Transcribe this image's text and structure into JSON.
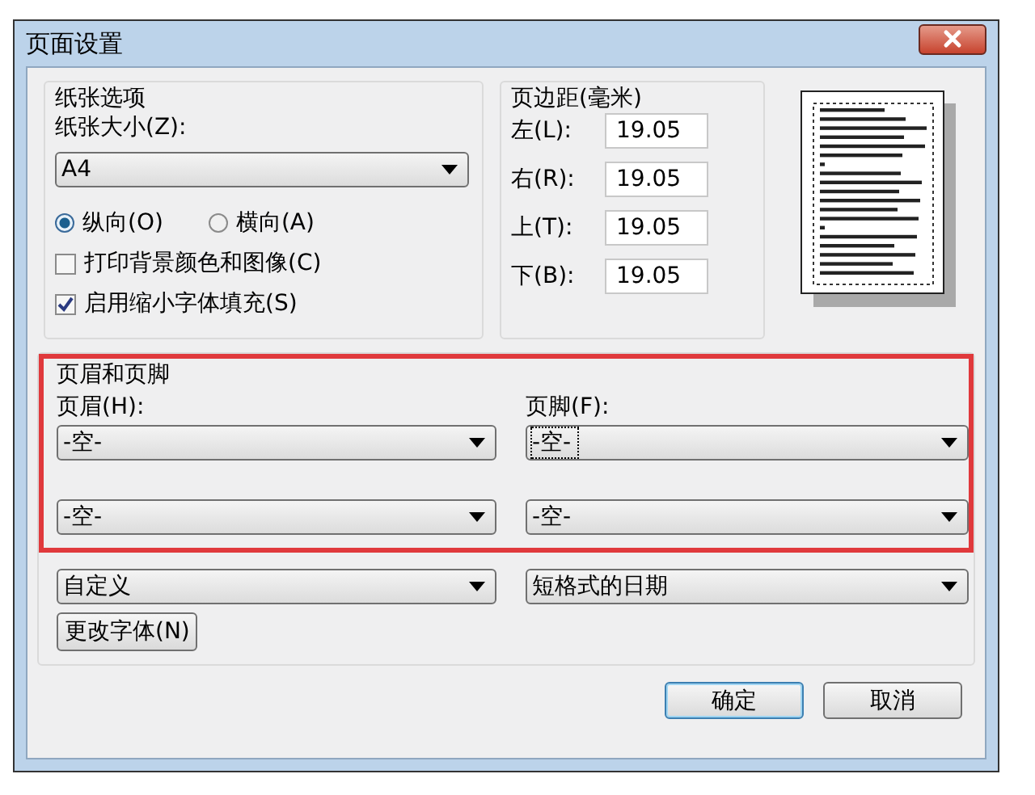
{
  "window": {
    "title": "页面设置"
  },
  "paper": {
    "group_label": "纸张选项",
    "size_label": "纸张大小(Z):",
    "size": "A4",
    "orientation": [
      {
        "label": "纵向(O)",
        "selected": true
      },
      {
        "label": "横向(A)",
        "selected": false
      }
    ],
    "options": [
      {
        "label": "打印背景颜色和图像(C)",
        "checked": false
      },
      {
        "label": "启用缩小字体填充(S)",
        "checked": true
      }
    ]
  },
  "margins": {
    "group_label": "页边距(毫米)",
    "fields": [
      {
        "label": "左(L):",
        "value": "19.05"
      },
      {
        "label": "右(R):",
        "value": "19.05"
      },
      {
        "label": "上(T):",
        "value": "19.05"
      },
      {
        "label": "下(B):",
        "value": "19.05"
      }
    ]
  },
  "header_footer": {
    "group_label": "页眉和页脚",
    "highlighted": true,
    "header_label": "页眉(H):",
    "footer_label": "页脚(F):",
    "rows": [
      {
        "header": "-空-",
        "footer": "-空-",
        "footer_focused": true
      },
      {
        "header": "-空-",
        "footer": "-空-",
        "footer_focused": false
      },
      {
        "header": "自定义",
        "footer": "短格式的日期",
        "footer_focused": false
      }
    ],
    "font_button": "更改字体(N)"
  },
  "buttons": [
    {
      "label": "确定",
      "default": true
    },
    {
      "label": "取消",
      "default": false
    }
  ]
}
